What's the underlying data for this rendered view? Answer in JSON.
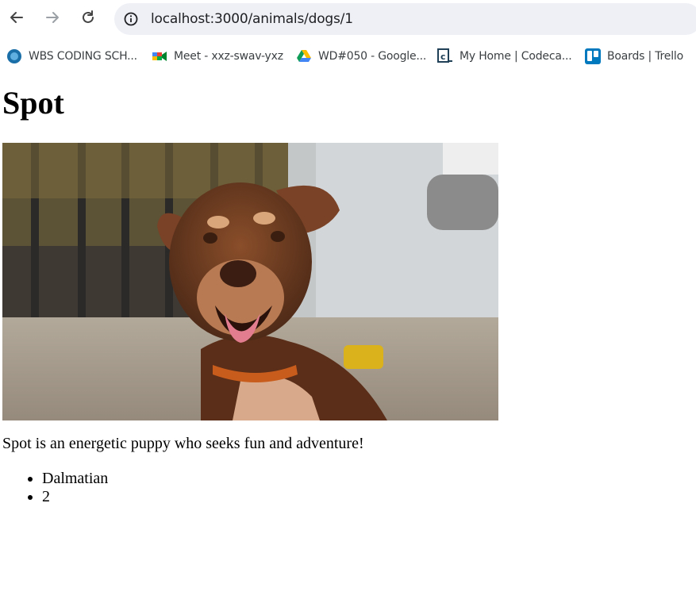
{
  "browser": {
    "url": "localhost:3000/animals/dogs/1",
    "bookmarks": [
      {
        "label": "WBS CODING SCH...",
        "icon": "wbs-logo-icon"
      },
      {
        "label": "Meet - xxz-swav-yxz",
        "icon": "google-meet-icon"
      },
      {
        "label": "WD#050 - Google...",
        "icon": "google-drive-icon"
      },
      {
        "label": "My Home | Codeca...",
        "icon": "codecademy-icon"
      },
      {
        "label": "Boards | Trello",
        "icon": "trello-icon"
      }
    ]
  },
  "page": {
    "title": "Spot",
    "image_alt": "brown dog photo",
    "description": "Spot is an energetic puppy who seeks fun and adventure!",
    "facts": [
      "Dalmatian",
      "2"
    ]
  }
}
